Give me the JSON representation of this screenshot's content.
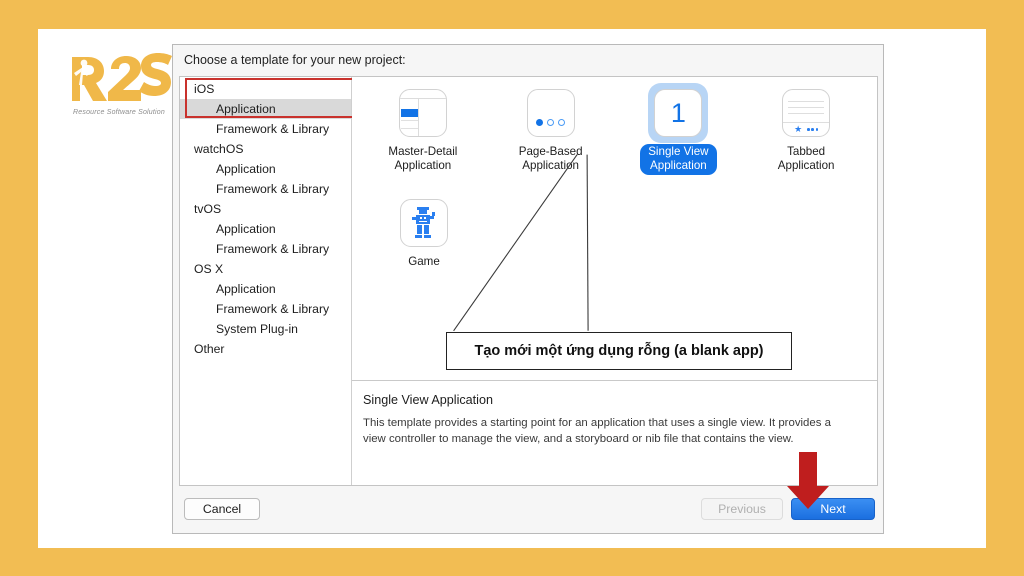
{
  "brand": {
    "logo_text": "R2S",
    "tagline": "Resource Software Solution",
    "logo_color": "#f0b849"
  },
  "theme": {
    "frame_color": "#f2bd53",
    "accent_blue": "#1273e6",
    "selection_blue": "#b8d5f5",
    "highlight_red": "#c9322d",
    "arrow_red": "#bf1e1e"
  },
  "dialog": {
    "title": "Choose a template for your new project:",
    "sidebar": {
      "items": [
        {
          "label": "iOS",
          "level": "group",
          "selected": false
        },
        {
          "label": "Application",
          "level": "child",
          "selected": true
        },
        {
          "label": "Framework & Library",
          "level": "child",
          "selected": false
        },
        {
          "label": "watchOS",
          "level": "group",
          "selected": false
        },
        {
          "label": "Application",
          "level": "child",
          "selected": false
        },
        {
          "label": "Framework & Library",
          "level": "child",
          "selected": false
        },
        {
          "label": "tvOS",
          "level": "group",
          "selected": false
        },
        {
          "label": "Application",
          "level": "child",
          "selected": false
        },
        {
          "label": "Framework & Library",
          "level": "child",
          "selected": false
        },
        {
          "label": "OS X",
          "level": "group",
          "selected": false
        },
        {
          "label": "Application",
          "level": "child",
          "selected": false
        },
        {
          "label": "Framework & Library",
          "level": "child",
          "selected": false
        },
        {
          "label": "System Plug-in",
          "level": "child",
          "selected": false
        },
        {
          "label": "Other",
          "level": "group",
          "selected": false
        }
      ]
    },
    "templates": [
      {
        "name": "Master-Detail Application",
        "line1": "Master-Detail",
        "line2": "Application",
        "icon": "master-detail-icon",
        "selected": false
      },
      {
        "name": "Page-Based Application",
        "line1": "Page-Based",
        "line2": "Application",
        "icon": "page-based-icon",
        "selected": false
      },
      {
        "name": "Single View Application",
        "line1": "Single View",
        "line2": "Application",
        "icon": "single-view-icon",
        "selected": true
      },
      {
        "name": "Tabbed Application",
        "line1": "Tabbed",
        "line2": "Application",
        "icon": "tabbed-icon",
        "selected": false
      },
      {
        "name": "Game",
        "line1": "Game",
        "line2": "",
        "icon": "game-icon",
        "selected": false
      }
    ],
    "single_view_icon_numeral": "1",
    "description": {
      "title": "Single View Application",
      "text": "This template provides a starting point for an application that uses a single view. It provides a view controller to manage the view, and a storyboard or nib file that contains the view."
    },
    "footer": {
      "cancel_label": "Cancel",
      "previous_label": "Previous",
      "next_label": "Next"
    }
  },
  "annotation": {
    "callout_text": "Tạo mới một ứng dụng rỗng (a blank app)"
  }
}
